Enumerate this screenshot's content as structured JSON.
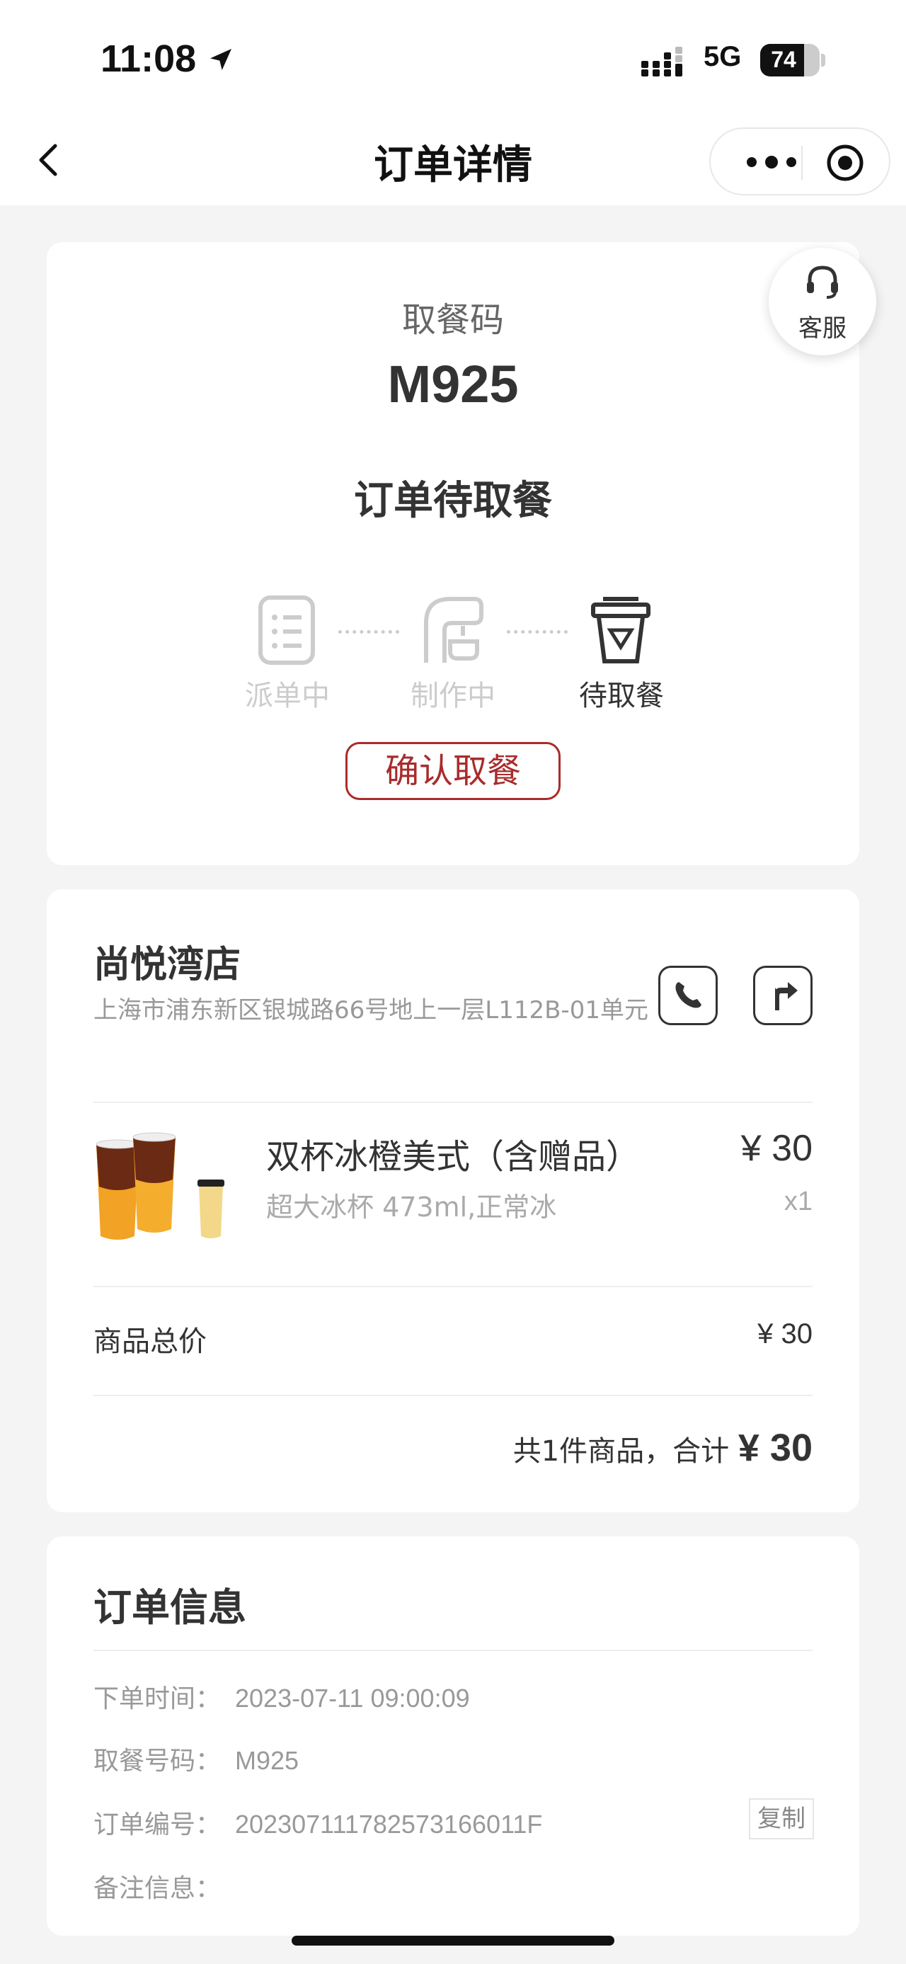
{
  "status_bar": {
    "time": "11:08",
    "network": "5G",
    "battery": "74",
    "battery_level": 0.74
  },
  "nav": {
    "title": "订单详情"
  },
  "pickup": {
    "label": "取餐码",
    "code": "M925",
    "status": "订单待取餐",
    "steps": [
      {
        "label": "派单中",
        "icon": "list-icon",
        "active": false
      },
      {
        "label": "制作中",
        "icon": "coffee-machine-icon",
        "active": false
      },
      {
        "label": "待取餐",
        "icon": "cup-icon",
        "active": true
      }
    ],
    "confirm_label": "确认取餐"
  },
  "service": {
    "label": "客服",
    "icon": "headset-icon"
  },
  "store": {
    "name": "尚悦湾店",
    "address": "上海市浦东新区银城路66号地上一层L112B-01单元"
  },
  "product": {
    "name": "双杯冰橙美式（含赠品）",
    "spec": "超大冰杯 473ml,正常冰",
    "price": "¥ 30",
    "qty": "x1"
  },
  "totals": {
    "goods_label": "商品总价",
    "goods_value": "¥ 30",
    "sum_prefix": "共1件商品，合计",
    "sum_value": "¥ 30"
  },
  "order_info": {
    "title": "订单信息",
    "rows": [
      {
        "key": "下单时间：",
        "value": "2023-07-11 09:00:09"
      },
      {
        "key": "取餐号码：",
        "value": "M925"
      },
      {
        "key": "订单编号：",
        "value": "202307111782573166011F"
      },
      {
        "key": "备注信息：",
        "value": ""
      }
    ],
    "copy_label": "复制"
  },
  "colors": {
    "accent": "#a82c2c",
    "background": "#f4f4f4"
  }
}
